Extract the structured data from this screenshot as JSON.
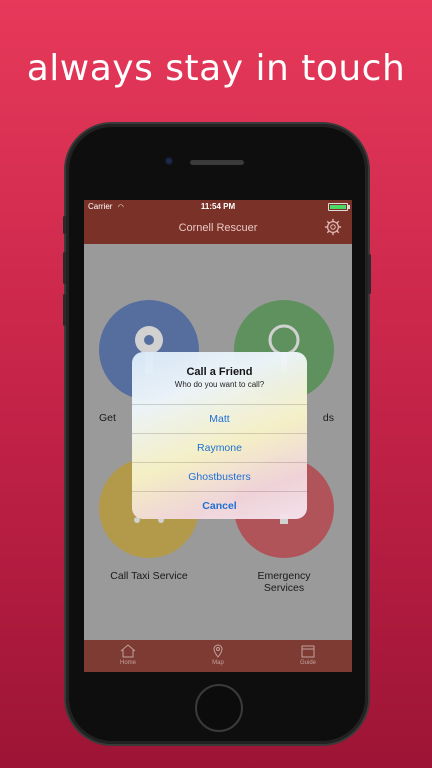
{
  "headline": "always stay in touch",
  "status_bar": {
    "carrier": "Carrier",
    "time": "11:54 PM"
  },
  "nav": {
    "title": "Cornell Rescuer",
    "settings_icon": "gear-icon"
  },
  "tiles": [
    {
      "label": "Get",
      "color": "#1d4ba3",
      "icon": "key-icon"
    },
    {
      "label": "ds",
      "color": "#2e8a2e",
      "icon": "key-icon"
    },
    {
      "label": "Call Taxi Service",
      "color": "#c89a0a",
      "icon": "taxi-icon"
    },
    {
      "label": "Emergency Services",
      "label_line1": "Emergency",
      "label_line2": "Services",
      "color": "#c31c24",
      "icon": "alert-icon"
    }
  ],
  "dialog": {
    "title": "Call a Friend",
    "subtitle": "Who do you want to call?",
    "options": [
      "Matt",
      "Raymone",
      "Ghostbusters"
    ],
    "cancel": "Cancel"
  },
  "tabs": [
    {
      "label": "Home",
      "icon": "home-icon"
    },
    {
      "label": "Map",
      "icon": "map-pin-icon"
    },
    {
      "label": "Guide",
      "icon": "book-icon"
    }
  ],
  "colors": {
    "background": "#d62b50",
    "navbar": "#7a3128",
    "dialog_button": "#1a6fd6"
  }
}
